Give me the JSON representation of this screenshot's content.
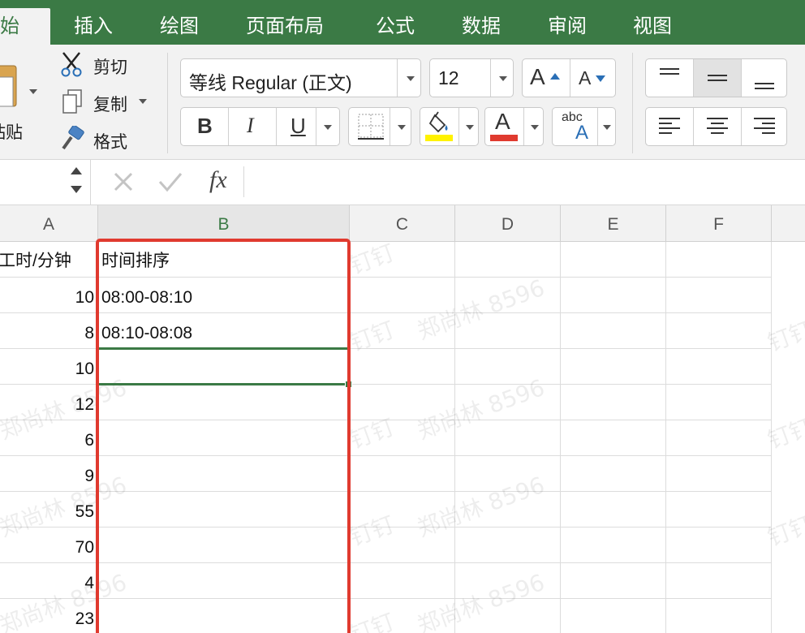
{
  "ribbon_tabs": [
    {
      "label": "开始",
      "active": true
    },
    {
      "label": "插入",
      "active": false
    },
    {
      "label": "绘图",
      "active": false
    },
    {
      "label": "页面布局",
      "active": false
    },
    {
      "label": "公式",
      "active": false
    },
    {
      "label": "数据",
      "active": false
    },
    {
      "label": "审阅",
      "active": false
    },
    {
      "label": "视图",
      "active": false
    }
  ],
  "clipboard": {
    "paste_label": "粘贴",
    "cut_label": "剪切",
    "copy_label": "复制",
    "format_label": "格式"
  },
  "font": {
    "name": "等线 Regular (正文)",
    "size": "12",
    "bold": "B",
    "italic": "I",
    "underline": "U",
    "font_color_letter": "A",
    "phonetic_small": "abc",
    "phonetic_big": "A",
    "fill_color": "#fff200",
    "font_color": "#e03a2f"
  },
  "formula_bar": {
    "fx_label": "fx",
    "content": ""
  },
  "columns": [
    "A",
    "B",
    "C",
    "D",
    "E",
    "F"
  ],
  "selected_column": "B",
  "column_a_header": "工时/分钟",
  "column_b_header": "时间排序",
  "column_a_values": [
    "10",
    "8",
    "10",
    "12",
    "6",
    "9",
    "55",
    "70",
    "4",
    "23"
  ],
  "column_b_values": [
    "08:00-08:10",
    "08:10-08:08",
    "",
    "",
    "",
    "",
    "",
    "",
    "",
    ""
  ],
  "watermark": [
    "郑尚林 8596",
    "钉钉"
  ],
  "colors": {
    "ribbon_green": "#3b7a45",
    "highlight_red": "#e03a2f"
  }
}
